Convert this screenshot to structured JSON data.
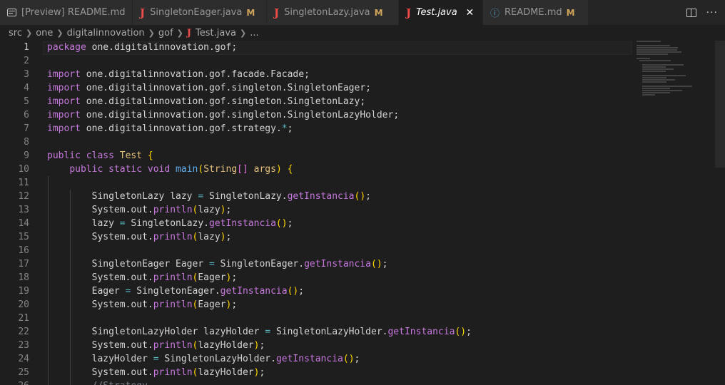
{
  "tabs": [
    {
      "label": "[Preview] README.md",
      "icon": "preview-icon",
      "modified": "",
      "active": false
    },
    {
      "label": "SingletonEager.java",
      "icon": "java-icon",
      "modified": "M",
      "active": false
    },
    {
      "label": "SingletonLazy.java",
      "icon": "java-icon",
      "modified": "M",
      "active": false
    },
    {
      "label": "Test.java",
      "icon": "java-icon",
      "modified": "",
      "active": true,
      "close": "✕"
    },
    {
      "label": "README.md",
      "icon": "info-icon",
      "modified": "M",
      "active": false
    }
  ],
  "breadcrumb": {
    "items": [
      "src",
      "one",
      "digitalinnovation",
      "gof",
      "Test.java",
      "..."
    ]
  },
  "editor": {
    "line_numbers": [
      "1",
      "2",
      "3",
      "4",
      "5",
      "6",
      "7",
      "8",
      "9",
      "10",
      "11",
      "12",
      "13",
      "14",
      "15",
      "16",
      "17",
      "18",
      "19",
      "20",
      "21",
      "22",
      "23",
      "24",
      "25",
      "26"
    ],
    "current_line": "1",
    "lines": [
      "package one.digitalinnovation.gof;",
      "",
      "import one.digitalinnovation.gof.facade.Facade;",
      "import one.digitalinnovation.gof.singleton.SingletonEager;",
      "import one.digitalinnovation.gof.singleton.SingletonLazy;",
      "import one.digitalinnovation.gof.singleton.SingletonLazyHolder;",
      "import one.digitalinnovation.gof.strategy.*;",
      "",
      "public class Test {",
      "    public static void main(String[] args) {",
      "",
      "        SingletonLazy lazy = SingletonLazy.getInstancia();",
      "        System.out.println(lazy);",
      "        lazy = SingletonLazy.getInstancia();",
      "        System.out.println(lazy);",
      "",
      "        SingletonEager Eager = SingletonEager.getInstancia();",
      "        System.out.println(Eager);",
      "        Eager = SingletonEager.getInstancia();",
      "        System.out.println(Eager);",
      "",
      "        SingletonLazyHolder lazyHolder = SingletonLazyHolder.getInstancia();",
      "        System.out.println(lazyHolder);",
      "        lazyHolder = SingletonLazyHolder.getInstancia();",
      "        System.out.println(lazyHolder);",
      "        //Strategy"
    ]
  },
  "colors": {
    "background": "#1e1e1e",
    "keyword": "#c678dd",
    "type": "#e5c07b",
    "method": "#c678dd",
    "java_icon": "#f14c4c",
    "modified": "#d0a55b"
  }
}
